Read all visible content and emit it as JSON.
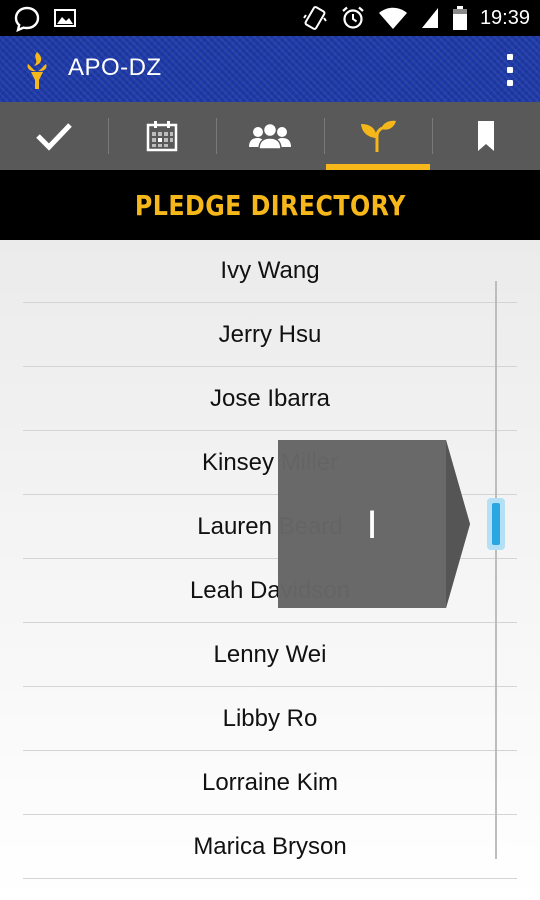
{
  "status_bar": {
    "time": "19:39",
    "icons": [
      "chat-bubble-icon",
      "image-icon",
      "vibrate-icon",
      "alarm-icon",
      "wifi-icon",
      "signal-icon",
      "battery-icon"
    ]
  },
  "app_bar": {
    "title": "APO-DZ",
    "logo": "torch-logo",
    "menu_icon": "overflow-menu-icon"
  },
  "tabs": [
    {
      "icon": "checkmark-icon",
      "active": false
    },
    {
      "icon": "calendar-icon",
      "active": false
    },
    {
      "icon": "people-icon",
      "active": false
    },
    {
      "icon": "sprout-icon",
      "active": true
    },
    {
      "icon": "bookmark-icon",
      "active": false
    }
  ],
  "section": {
    "title": "PLEDGE DIRECTORY"
  },
  "pledges": [
    "Ivy Wang",
    "Jerry Hsu",
    "Jose Ibarra",
    "Kinsey Miller",
    "Lauren Beard",
    "Leah Davidson",
    "Lenny Wei",
    "Libby Ro",
    "Lorraine Kim",
    "Marica Bryson"
  ],
  "fast_scroll": {
    "section_letter": "I"
  },
  "colors": {
    "app_bar": "#1e3aa8",
    "accent": "#f6b71a",
    "tab_bar": "#595959",
    "header_bg": "#000000",
    "scroll_thumb": "#2aa7e0",
    "overlay": "#666666"
  }
}
